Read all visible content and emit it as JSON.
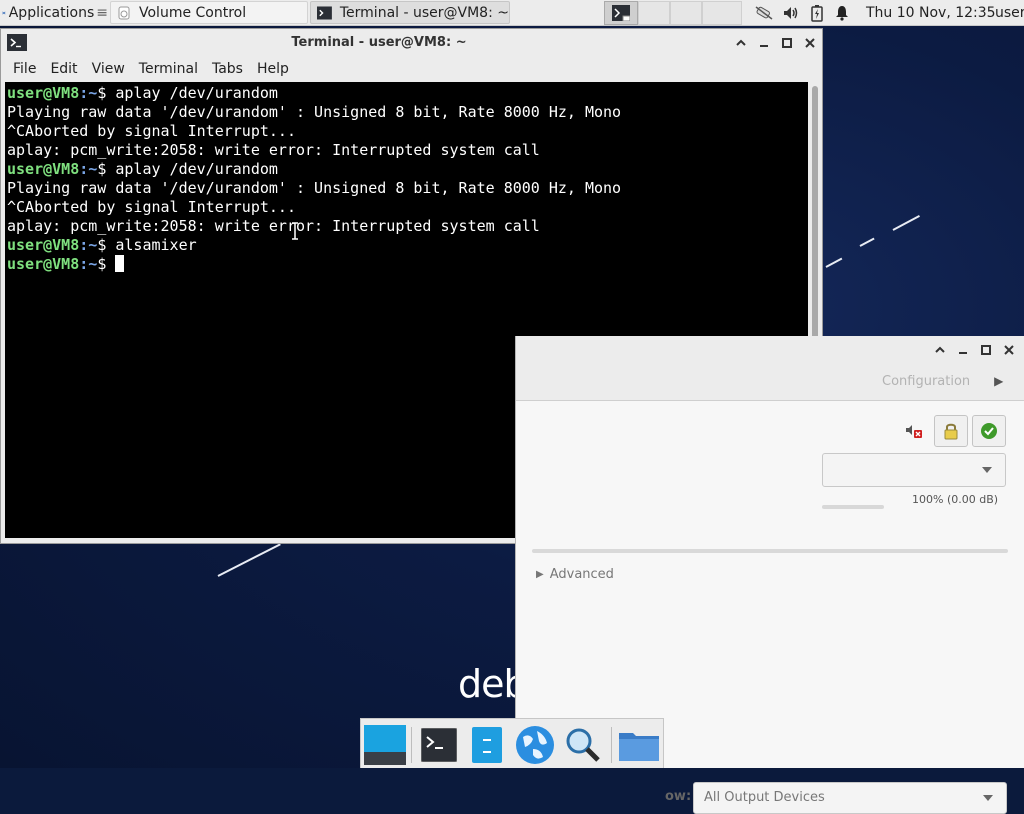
{
  "top_panel": {
    "applications_label": "Applications",
    "tasks": [
      {
        "label": "Volume Control"
      },
      {
        "label": "Terminal - user@VM8: ~"
      }
    ],
    "clock": "Thu 10 Nov, 12:35",
    "user_label": "user"
  },
  "terminal": {
    "title": "Terminal - user@VM8: ~",
    "menu": [
      "File",
      "Edit",
      "View",
      "Terminal",
      "Tabs",
      "Help"
    ],
    "prompt_user": "user@VM8",
    "prompt_path": ":~",
    "prompt_symbol": "$ ",
    "lines": [
      {
        "type": "prompt",
        "cmd": "aplay /dev/urandom"
      },
      {
        "type": "out",
        "text": "Playing raw data '/dev/urandom' : Unsigned 8 bit, Rate 8000 Hz, Mono"
      },
      {
        "type": "out",
        "text": "^CAborted by signal Interrupt..."
      },
      {
        "type": "out",
        "text": "aplay: pcm_write:2058: write error: Interrupted system call"
      },
      {
        "type": "prompt",
        "cmd": "aplay /dev/urandom"
      },
      {
        "type": "out",
        "text": "Playing raw data '/dev/urandom' : Unsigned 8 bit, Rate 8000 Hz, Mono"
      },
      {
        "type": "out",
        "text": "^CAborted by signal Interrupt..."
      },
      {
        "type": "out",
        "text": "aplay: pcm_write:2058: write error: Interrupted system call"
      },
      {
        "type": "prompt",
        "cmd": "alsamixer"
      },
      {
        "type": "prompt",
        "cmd": "",
        "cursor": true
      }
    ]
  },
  "volume_control": {
    "tab_configuration": "Configuration",
    "volume_percent": "100% (0.00 dB)",
    "volume_level": 1.0,
    "advanced_label": "Advanced",
    "show_label": "ow:",
    "show_value": "All Output Devices"
  },
  "desktop": {
    "wallpaper_text": "deb"
  },
  "dock": {
    "items": [
      "show-desktop",
      "terminal",
      "file-manager-panel",
      "web-browser",
      "app-finder",
      "files-folder"
    ]
  },
  "colors": {
    "prompt_user": "#7fe07f",
    "prompt_path": "#7aa5e6",
    "terminal_bg": "#000000",
    "panel_bg": "#ececec",
    "desktop_bg": "#0c1b42"
  }
}
